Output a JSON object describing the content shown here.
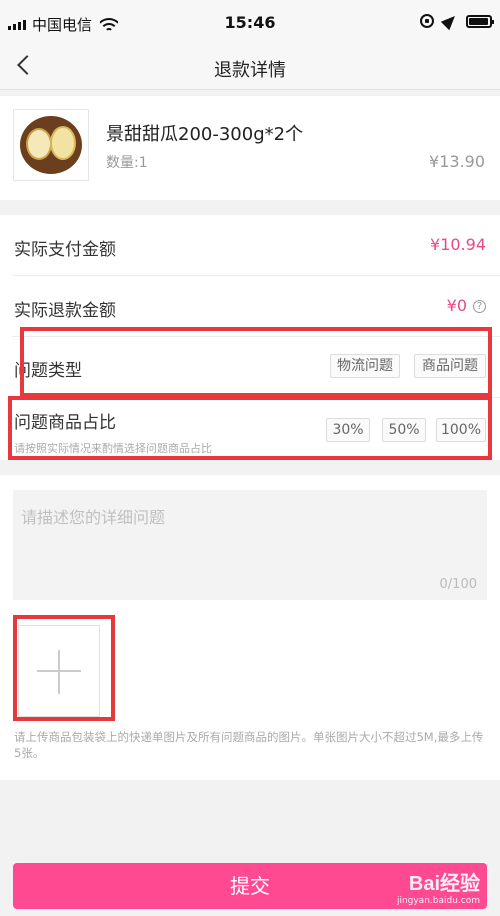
{
  "status_bar": {
    "carrier": "中国电信",
    "time": "15:46"
  },
  "nav": {
    "title": "退款详情"
  },
  "product": {
    "name": "景甜甜瓜200-300g*2个",
    "quantity": "数量:1",
    "price": "¥13.90"
  },
  "info": {
    "paid_label": "实际支付金额",
    "paid_value": "¥10.94",
    "refund_label": "实际退款金额",
    "refund_value": "¥0",
    "help_symbol": "?",
    "issue_type_label": "问题类型",
    "issue_types": [
      "物流问题",
      "商品问题"
    ],
    "ratio_label": "问题商品占比",
    "ratio_hint": "请按照实际情况来酌情选择问题商品占比",
    "ratios": [
      "30%",
      "50%",
      "100%"
    ]
  },
  "description": {
    "placeholder": "请描述您的详细问题",
    "count": "0/100"
  },
  "upload": {
    "hint": "请上传商品包装袋上的快递单图片及所有问题商品的图片。单张图片大小不超过5M,最多上传5张。"
  },
  "submit_label": "提交",
  "watermark": {
    "main": "Bai经验",
    "sub": "jingyan.baidu.com"
  },
  "colors": {
    "accent": "#ff4a92",
    "price": "#e64a89",
    "highlight": "#e8383d"
  }
}
